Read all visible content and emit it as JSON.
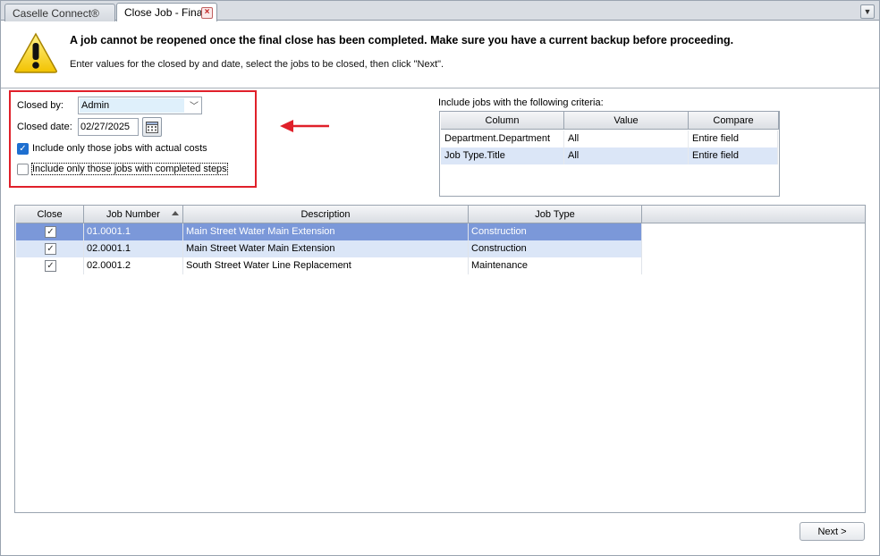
{
  "tabs": [
    {
      "label": "Caselle Connect®",
      "active": false
    },
    {
      "label": "Close Job - Final",
      "active": true
    }
  ],
  "header": {
    "title": "A job cannot be reopened once the final close has been completed. Make sure you have a current backup before proceeding.",
    "instruction": "Enter values for the closed by and date, select the jobs to be closed, then click \"Next\"."
  },
  "form": {
    "closed_by_label": "Closed by:",
    "closed_by_value": "Admin",
    "closed_date_label": "Closed date:",
    "closed_date_value": "02/27/2025",
    "chk_actual_costs_label": "Include only those jobs with actual costs",
    "chk_actual_costs_checked": true,
    "chk_completed_steps_label": "Include only those jobs with completed steps",
    "chk_completed_steps_checked": false
  },
  "criteria": {
    "caption": "Include jobs with the following criteria:",
    "columns": [
      "Column",
      "Value",
      "Compare"
    ],
    "rows": [
      {
        "column": "Department.Department",
        "value": "All",
        "compare": "Entire field"
      },
      {
        "column": "Job Type.Title",
        "value": "All",
        "compare": "Entire field"
      }
    ]
  },
  "jobs": {
    "columns": [
      "Close",
      "Job Number",
      "Description",
      "Job Type"
    ],
    "rows": [
      {
        "close": true,
        "job_number": "01.0001.1",
        "description": "Main Street Water Main Extension",
        "job_type": "Construction"
      },
      {
        "close": true,
        "job_number": "02.0001.1",
        "description": "Main Street Water Main Extension",
        "job_type": "Construction"
      },
      {
        "close": true,
        "job_number": "02.0001.2",
        "description": "South Street Water Line Replacement",
        "job_type": "Maintenance"
      }
    ]
  },
  "footer": {
    "next_label": "Next >"
  },
  "colors": {
    "highlight_box": "#e0202a",
    "selected_row": "#7b98d9",
    "alt_row": "#dbe6f7",
    "checkbox_on": "#1e6fd0"
  }
}
